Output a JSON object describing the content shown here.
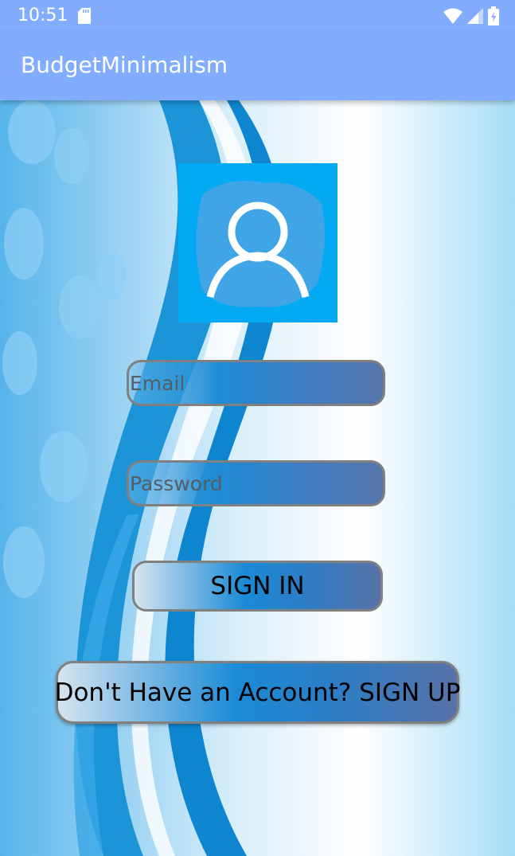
{
  "status_bar": {
    "time": "10:51",
    "icons": [
      "sd-card-icon",
      "wifi-icon",
      "signal-icon",
      "battery-icon"
    ]
  },
  "app_bar": {
    "title": "BudgetMinimalism"
  },
  "login": {
    "email_placeholder": "Email",
    "email_value": "",
    "password_placeholder": "Password",
    "password_value": "",
    "sign_in_label": "SIGN IN",
    "sign_up_label": "Don't Have an Account? SIGN UP"
  },
  "colors": {
    "app_bar": "#82acfd",
    "avatar_bg": "#04a9f4",
    "field_border": "#808080"
  }
}
